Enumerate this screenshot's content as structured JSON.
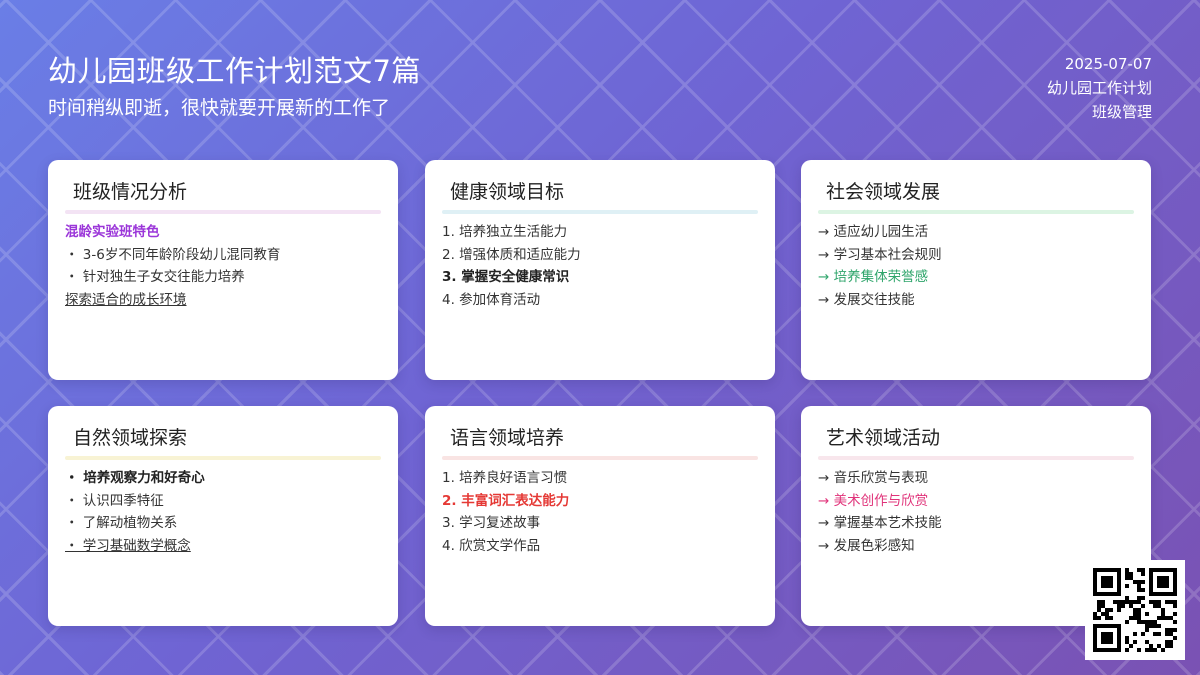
{
  "header": {
    "title": "幼儿园班级工作计划范文7篇",
    "subtitle": "时间稍纵即逝，很快就要开展新的工作了"
  },
  "meta": {
    "date": "2025-07-07",
    "category": "幼儿园工作计划",
    "tag": "班级管理"
  },
  "cards": [
    {
      "title": "班级情况分析",
      "divider_color": "#f3e3f4",
      "lines": [
        "混龄实验班特色",
        "・ 3-6岁不同年龄阶段幼儿混同教育",
        "・ 针对独生子女交往能力培养",
        "探索适合的成长环境"
      ]
    },
    {
      "title": "健康领域目标",
      "divider_color": "#dff0f5",
      "lines": [
        "1. 培养独立生活能力",
        "2. 增强体质和适应能力",
        "3. 掌握安全健康常识",
        "4. 参加体育活动"
      ]
    },
    {
      "title": "社会领域发展",
      "divider_color": "#dcf4e3",
      "lines": [
        "→ 适应幼儿园生活",
        "→ 学习基本社会规则",
        "→ 培养集体荣誉感",
        "→ 发展交往技能"
      ]
    },
    {
      "title": "自然领域探索",
      "divider_color": "#f8f3d4",
      "lines": [
        "・ 培养观察力和好奇心",
        "・ 认识四季特征",
        "・ 了解动植物关系",
        "・ 学习基础数学概念"
      ]
    },
    {
      "title": "语言领域培养",
      "divider_color": "#f9e4e3",
      "lines": [
        "1. 培养良好语言习惯",
        "2. 丰富词汇表达能力",
        "3. 学习复述故事",
        "4. 欣赏文学作品"
      ]
    },
    {
      "title": "艺术领域活动",
      "divider_color": "#f8e6ec",
      "lines": [
        "→ 音乐欣赏与表现",
        "→ 美术创作与欣赏",
        "→ 掌握基本艺术技能",
        "→ 发展色彩感知"
      ]
    }
  ],
  "qr_code": {
    "icon": "qr-code-icon"
  }
}
